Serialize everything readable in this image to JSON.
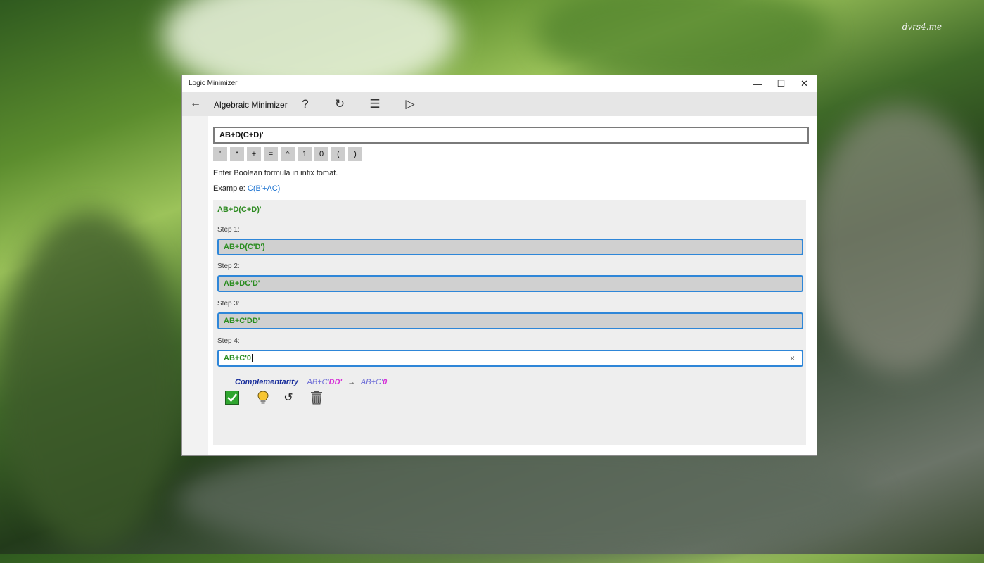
{
  "desktop": {
    "watermark": "dvrs4.me"
  },
  "window": {
    "title": "Logic Minimizer",
    "controls": {
      "minimize": "—",
      "maximize": "☐",
      "close": "✕"
    }
  },
  "toolbar": {
    "back_icon": "←",
    "title": "Algebraic Minimizer",
    "help_icon": "?",
    "refresh_icon": "↻",
    "list_icon": "☰",
    "play_icon": "▷"
  },
  "input": {
    "value": "AB+D(C+D)'"
  },
  "keys": [
    "'",
    "*",
    "+",
    "=",
    "^",
    "1",
    "0",
    "(",
    ")"
  ],
  "hint": "Enter Boolean formula in infix fomat.",
  "example": {
    "label": "Example: ",
    "value": "C(B'+AC)"
  },
  "results": {
    "original": "AB+D(C+D)'",
    "steps": [
      {
        "label": "Step 1:",
        "value": "AB+D(C'D')"
      },
      {
        "label": "Step 2:",
        "value": "AB+DC'D'"
      },
      {
        "label": "Step 3:",
        "value": "AB+C'DD'"
      },
      {
        "label": "Step 4:",
        "value": "AB+C'0"
      }
    ],
    "clear_icon": "×",
    "rule": {
      "name": "Complementarity",
      "from_prefix": "AB+C'",
      "from_highlight": "DD'",
      "arrow": "→",
      "to_prefix": "AB+C'",
      "to_highlight": "0"
    }
  },
  "actions": {
    "accept_icon": "checkbox-check-icon",
    "hint_icon": "lightbulb-icon",
    "undo_icon": "↺",
    "delete_icon": "trash-icon"
  },
  "colors": {
    "accent": "#2e86d8",
    "result_green": "#2e8b22",
    "rule_name": "#1a2f9c",
    "rule_highlight": "#d62fd6",
    "link": "#1b72d1"
  }
}
